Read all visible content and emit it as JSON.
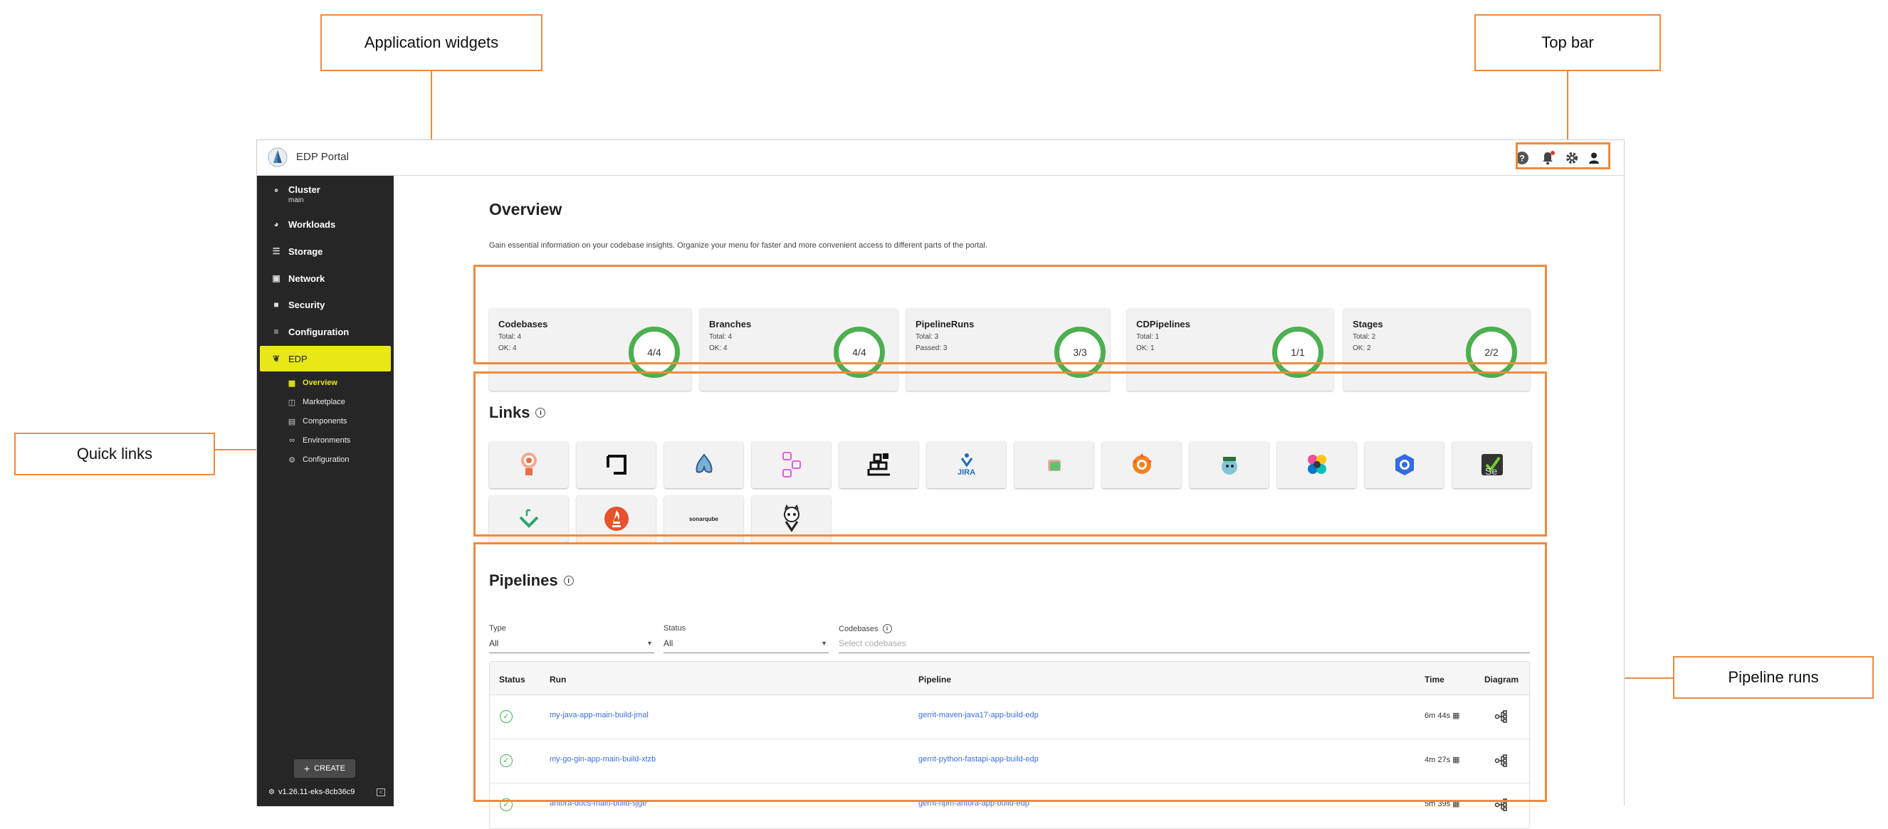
{
  "callouts": {
    "application_widgets": "Application widgets",
    "top_bar": "Top bar",
    "quick_links": "Quick links",
    "pipeline_runs": "Pipeline runs"
  },
  "app": {
    "title": "EDP Portal"
  },
  "sidebar": {
    "items": [
      {
        "label": "Cluster",
        "sublabel": "main",
        "icon": "cluster-icon"
      },
      {
        "label": "Workloads",
        "icon": "workloads-icon"
      },
      {
        "label": "Storage",
        "icon": "storage-icon"
      },
      {
        "label": "Network",
        "icon": "network-icon"
      },
      {
        "label": "Security",
        "icon": "lock-icon"
      },
      {
        "label": "Configuration",
        "icon": "configuration-icon"
      },
      {
        "label": "EDP",
        "icon": "edp-icon",
        "active": true
      }
    ],
    "subitems": [
      {
        "label": "Overview",
        "icon": "overview-icon",
        "active": true
      },
      {
        "label": "Marketplace",
        "icon": "marketplace-icon"
      },
      {
        "label": "Components",
        "icon": "components-icon"
      },
      {
        "label": "Environments",
        "icon": "environments-icon"
      },
      {
        "label": "Configuration",
        "icon": "gear-icon"
      }
    ],
    "create_label": "CREATE",
    "version": "v1.26.11-eks-8cb36c9"
  },
  "overview": {
    "title": "Overview",
    "description": "Gain essential information on your codebase insights. Organize your menu for faster and more convenient access to different parts of the portal."
  },
  "widgets": [
    {
      "title": "Codebases",
      "line1": "Total: 4",
      "line2": "OK: 4",
      "ring": "4/4"
    },
    {
      "title": "Branches",
      "line1": "Total: 4",
      "line2": "OK: 4",
      "ring": "4/4"
    },
    {
      "title": "PipelineRuns",
      "line1": "Total: 3",
      "line2": "Passed: 3",
      "ring": "3/3"
    },
    {
      "title": "CDPipelines",
      "line1": "Total: 1",
      "line2": "OK: 1",
      "ring": "1/1"
    },
    {
      "title": "Stages",
      "line1": "Total: 2",
      "line2": "OK: 2",
      "ring": "2/2"
    }
  ],
  "links": {
    "title": "Links",
    "jira_text": "JIRA",
    "sonar_text": "sonarqube"
  },
  "pipelines": {
    "title": "Pipelines",
    "filters": {
      "type_label": "Type",
      "type_value": "All",
      "status_label": "Status",
      "status_value": "All",
      "codebases_label": "Codebases",
      "codebases_placeholder": "Select codebases"
    },
    "columns": {
      "status": "Status",
      "run": "Run",
      "pipeline": "Pipeline",
      "time": "Time",
      "diagram": "Diagram"
    },
    "rows": [
      {
        "run": "my-java-app-main-build-jmal",
        "pipeline": "gerrit-maven-java17-app-build-edp",
        "time": "6m 44s"
      },
      {
        "run": "my-go-gin-app-main-build-xtzb",
        "pipeline": "gerrit-python-fastapi-app-build-edp",
        "time": "4m 27s"
      },
      {
        "run": "antora-docs-main-build-sjge",
        "pipeline": "gerrit-npm-antora-app-build-edp",
        "time": "5m 39s"
      }
    ]
  },
  "colors": {
    "accent": "#f08a3c",
    "edp_active": "#e8e817",
    "success": "#4caf50",
    "sidebar": "#262626"
  }
}
